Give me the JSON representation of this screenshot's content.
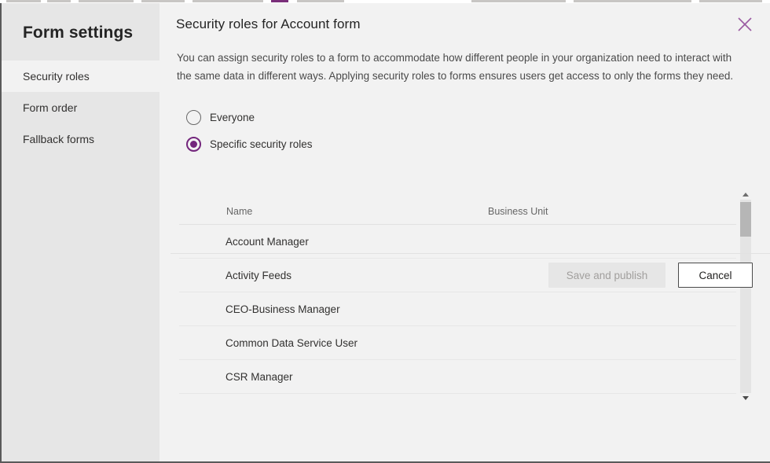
{
  "sidebar": {
    "title": "Form settings",
    "items": [
      {
        "label": "Security roles",
        "selected": true
      },
      {
        "label": "Form order",
        "selected": false
      },
      {
        "label": "Fallback forms",
        "selected": false
      }
    ]
  },
  "dialog": {
    "title": "Security roles for Account form",
    "description": "You can assign security roles to a form to accommodate how different people in your organization need to interact with the same data in different ways. Applying security roles to forms ensures users get access to only the forms they need.",
    "close_icon": "close-icon",
    "close_icon_color": "#9a5aa2"
  },
  "options": {
    "selected": "Specific security roles",
    "choices": [
      {
        "label": "Everyone",
        "checked": false
      },
      {
        "label": "Specific security roles",
        "checked": true
      }
    ],
    "accent_color": "#73267c"
  },
  "table": {
    "columns": [
      "Name",
      "Business Unit"
    ],
    "rows": [
      {
        "name": "Account Manager",
        "business_unit": ""
      },
      {
        "name": "Activity Feeds",
        "business_unit": ""
      },
      {
        "name": "CEO-Business Manager",
        "business_unit": ""
      },
      {
        "name": "Common Data Service User",
        "business_unit": ""
      },
      {
        "name": "CSR Manager",
        "business_unit": ""
      }
    ],
    "scrollbar": {
      "up_icon": "chevron-up-icon",
      "down_icon": "chevron-down-icon"
    }
  },
  "footer": {
    "save_label": "Save and publish",
    "save_disabled": true,
    "cancel_label": "Cancel"
  }
}
